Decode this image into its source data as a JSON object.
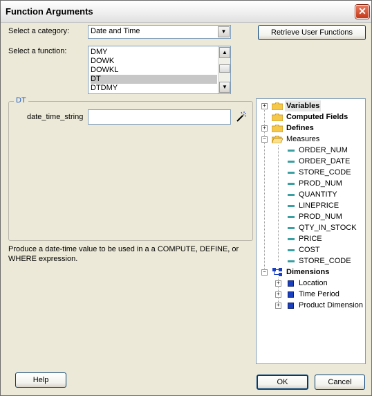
{
  "window": {
    "title": "Function Arguments",
    "close_glyph": "✕"
  },
  "category": {
    "label": "Select a category:",
    "value": "Date and Time"
  },
  "retrieve_button": "Retrieve User Functions",
  "function": {
    "label": "Select a function:",
    "items": [
      "DMY",
      "DOWK",
      "DOWKL",
      "DT",
      "DTDMY"
    ],
    "selected": "DT"
  },
  "argument_group": {
    "legend": "DT",
    "field_label": "date_time_string",
    "field_value": ""
  },
  "description": "Produce a date-time value to be used in a a COMPUTE, DEFINE, or WHERE expression.",
  "tree": {
    "variables": "Variables",
    "computed": "Computed Fields",
    "defines": "Defines",
    "measures_label": "Measures",
    "measures": [
      "ORDER_NUM",
      "ORDER_DATE",
      "STORE_CODE",
      "PROD_NUM",
      "QUANTITY",
      "LINEPRICE",
      "PROD_NUM",
      "QTY_IN_STOCK",
      "PRICE",
      "COST",
      "STORE_CODE"
    ],
    "dimensions_label": "Dimensions",
    "dimensions": [
      "Location",
      "Time Period",
      "Product Dimension"
    ]
  },
  "buttons": {
    "help": "Help",
    "ok": "OK",
    "cancel": "Cancel"
  },
  "colors": {
    "accent": "#1f5fbf",
    "selection": "#c7c7c7",
    "leaf": "#3a9fa0",
    "folder": "#f5c84a"
  },
  "icons": {
    "close": "close-icon",
    "wand": "magic-wand-icon",
    "folder": "folder-icon",
    "leaf": "field-leaf-icon",
    "dimension": "dimension-icon"
  }
}
